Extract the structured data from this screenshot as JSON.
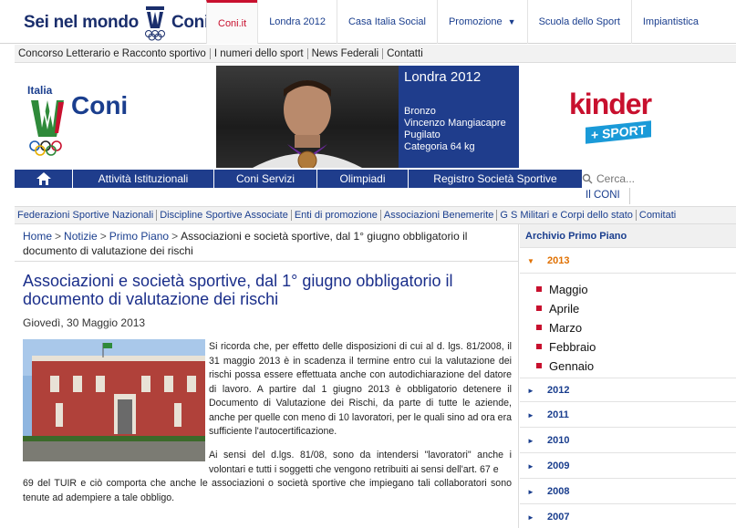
{
  "brand": {
    "left": "Sei nel mondo",
    "right": "Coni"
  },
  "topnav": [
    {
      "label": "Coni.it",
      "active": true
    },
    {
      "label": "Londra 2012"
    },
    {
      "label": "Casa Italia Social"
    },
    {
      "label": "Promozione",
      "caret": "▼"
    },
    {
      "label": "Scuola dello Sport"
    },
    {
      "label": "Impiantistica"
    }
  ],
  "sublinks": [
    "Concorso Letterario e Racconto sportivo",
    "I numeri dello sport",
    "News Federali",
    "Contatti"
  ],
  "logo": {
    "italia": "Italia",
    "coni": "Coni"
  },
  "londra": {
    "title": "Londra 2012",
    "lines": [
      "Bronzo",
      "Vincenzo Mangiacapre",
      "Pugilato",
      "Categoria 64 kg"
    ]
  },
  "sponsor": {
    "name": "kinder",
    "sub": "+ SPORT"
  },
  "mainnav": [
    "Attività Istituzionali",
    "Coni Servizi",
    "Olimpiadi",
    "Registro Società Sportive"
  ],
  "search": {
    "placeholder": "Cerca..."
  },
  "ilconi": "Il CONI",
  "categories": [
    "Federazioni Sportive Nazionali",
    "Discipline Sportive Associate",
    "Enti di promozione",
    "Associazioni Benemerite",
    "G S Militari e Corpi dello stato",
    "Comitati"
  ],
  "breadcrumb": {
    "home": "Home",
    "notizie": "Notizie",
    "primo": "Primo Piano",
    "sep": ">",
    "current": "Associazioni e società sportive, dal 1° giugno obbligatorio il documento di valutazione dei rischi"
  },
  "article": {
    "title": "Associazioni e società sportive, dal 1° giugno obbligatorio il documento di valutazione dei rischi",
    "date": "Giovedì, 30 Maggio 2013",
    "para1": "Si ricorda che, per effetto delle disposizioni di cui al d. lgs. 81/2008, il 31 maggio 2013 è in scadenza il termine entro cui la valutazione dei rischi possa essere effettuata anche con autodichiarazione del datore di lavoro. A partire dal 1 giugno 2013 è obbligatorio detenere il Documento di Valutazione dei Rischi, da parte di tutte le aziende, anche per quelle con meno di 10 lavoratori, per le quali sino ad ora era sufficiente l'autocertificazione.",
    "para2_first": "Ai sensi del d.lgs. 81/08, sono da intendersi \"lavoratori\" anche i volontari e tutti i soggetti che vengono retribuiti ai sensi dell'art. 67 e",
    "para2_rest": "69 del TUIR e ciò comporta che anche le associazioni o società sportive che impiegano tali collaboratori sono tenute ad adempiere a tale obbligo."
  },
  "sidebar": {
    "header": "Archivio Primo Piano",
    "open_year": "2013",
    "months": [
      "Maggio",
      "Aprile",
      "Marzo",
      "Febbraio",
      "Gennaio"
    ],
    "years": [
      "2012",
      "2011",
      "2010",
      "2009",
      "2008",
      "2007"
    ]
  },
  "colors": {
    "navy": "#1f3d8c",
    "red": "#c8102e",
    "orange": "#e07000"
  }
}
